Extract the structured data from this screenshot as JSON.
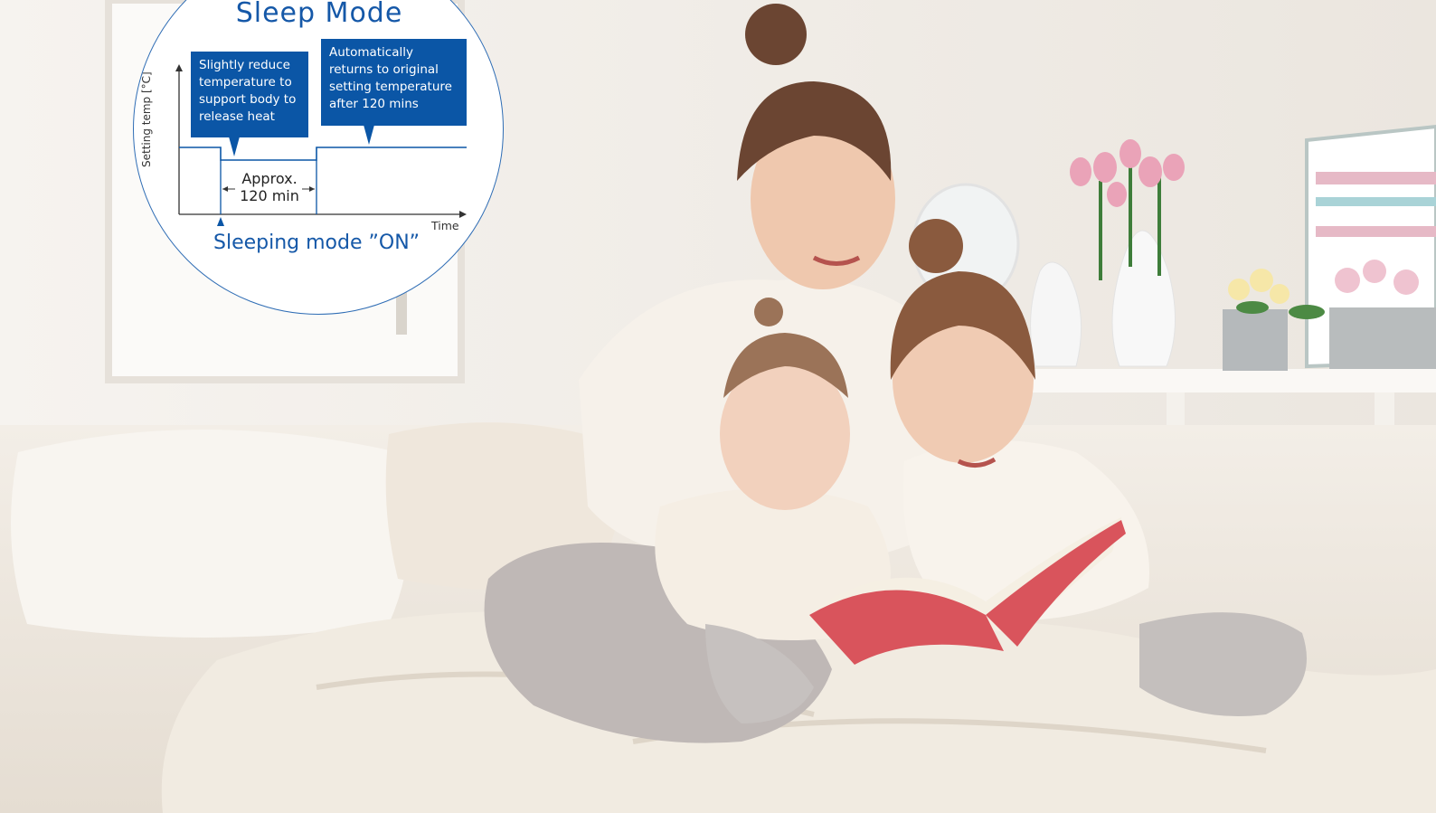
{
  "diagram": {
    "title": "Sleep Mode",
    "note_reduce": "Slightly reduce temperature to support body to release heat",
    "note_return": "Automatically returns to original setting temperature after 120 mins",
    "y_axis_label": "Setting temp [°C]",
    "duration_label_1": "Approx.",
    "duration_label_2": "120 min",
    "x_axis_label": "Time",
    "mode_on_label": "Sleeping mode ”ON”"
  },
  "colors": {
    "accent": "#0b56a6",
    "badge_border": "#2f6db5",
    "book_red": "#d9545c"
  }
}
